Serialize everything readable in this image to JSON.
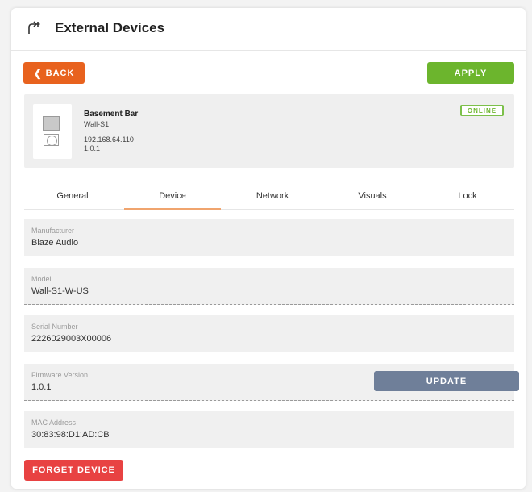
{
  "header": {
    "title": "External Devices",
    "icon": "external-devices-icon"
  },
  "toolbar": {
    "back_label": "BACK",
    "back_icon": "chevron-left-icon",
    "apply_label": "APPLY"
  },
  "device": {
    "name": "Basement Bar",
    "model_short": "Wall-S1",
    "ip": "192.168.64.110",
    "version": "1.0.1",
    "status": "ONLINE"
  },
  "tabs": [
    {
      "label": "General"
    },
    {
      "label": "Device",
      "active": true
    },
    {
      "label": "Network"
    },
    {
      "label": "Visuals"
    },
    {
      "label": "Lock"
    }
  ],
  "fields": {
    "manufacturer": {
      "label": "Manufacturer",
      "value": "Blaze Audio"
    },
    "model": {
      "label": "Model",
      "value": "Wall-S1-W-US"
    },
    "serial": {
      "label": "Serial Number",
      "value": "2226029003X00006"
    },
    "firmware": {
      "label": "Firmware Version",
      "value": "1.0.1",
      "action_label": "UPDATE"
    },
    "mac": {
      "label": "MAC Address",
      "value": "30:83:98:D1:AD:CB"
    }
  },
  "footer": {
    "forget_label": "FORGET DEVICE"
  },
  "colors": {
    "back": "#e8621e",
    "apply": "#6cb52d",
    "online": "#6cb52d",
    "tab_active_underline": "#f0a46e",
    "update": "#6f7f99",
    "forget": "#e84242"
  }
}
